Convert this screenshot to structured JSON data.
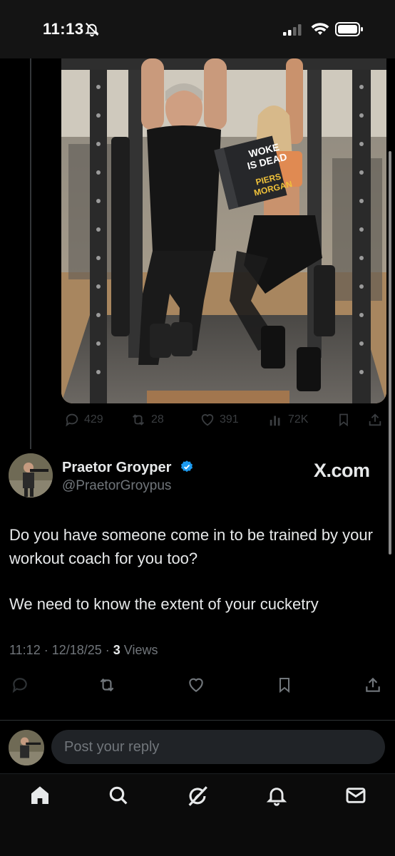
{
  "status_bar": {
    "time": "11:13"
  },
  "post_image": {
    "book_title_line1": "WOKE",
    "book_title_line2": "IS DEAD",
    "book_author_line1": "PIERS",
    "book_author_line2": "MORGAN"
  },
  "quoted_actions": {
    "replies": "429",
    "reposts": "28",
    "likes": "391",
    "views": "72K"
  },
  "author": {
    "display_name": "Praetor Groyper",
    "handle": "@PraetorGroypus"
  },
  "watermark": "X.com",
  "tweet": {
    "paragraph1": "Do you have someone come in to be trained by your workout coach for you too?",
    "paragraph2": "We need to know the extent of your cucketry"
  },
  "meta": {
    "timestamp": "11:12 · 12/18/25 · ",
    "views_count": "3",
    "views_label": " Views"
  },
  "reply": {
    "placeholder": "Post your reply"
  },
  "colors": {
    "background": "#000000",
    "accent": "#1d9bf0",
    "muted": "#71767b",
    "text": "#e7e9ea"
  }
}
